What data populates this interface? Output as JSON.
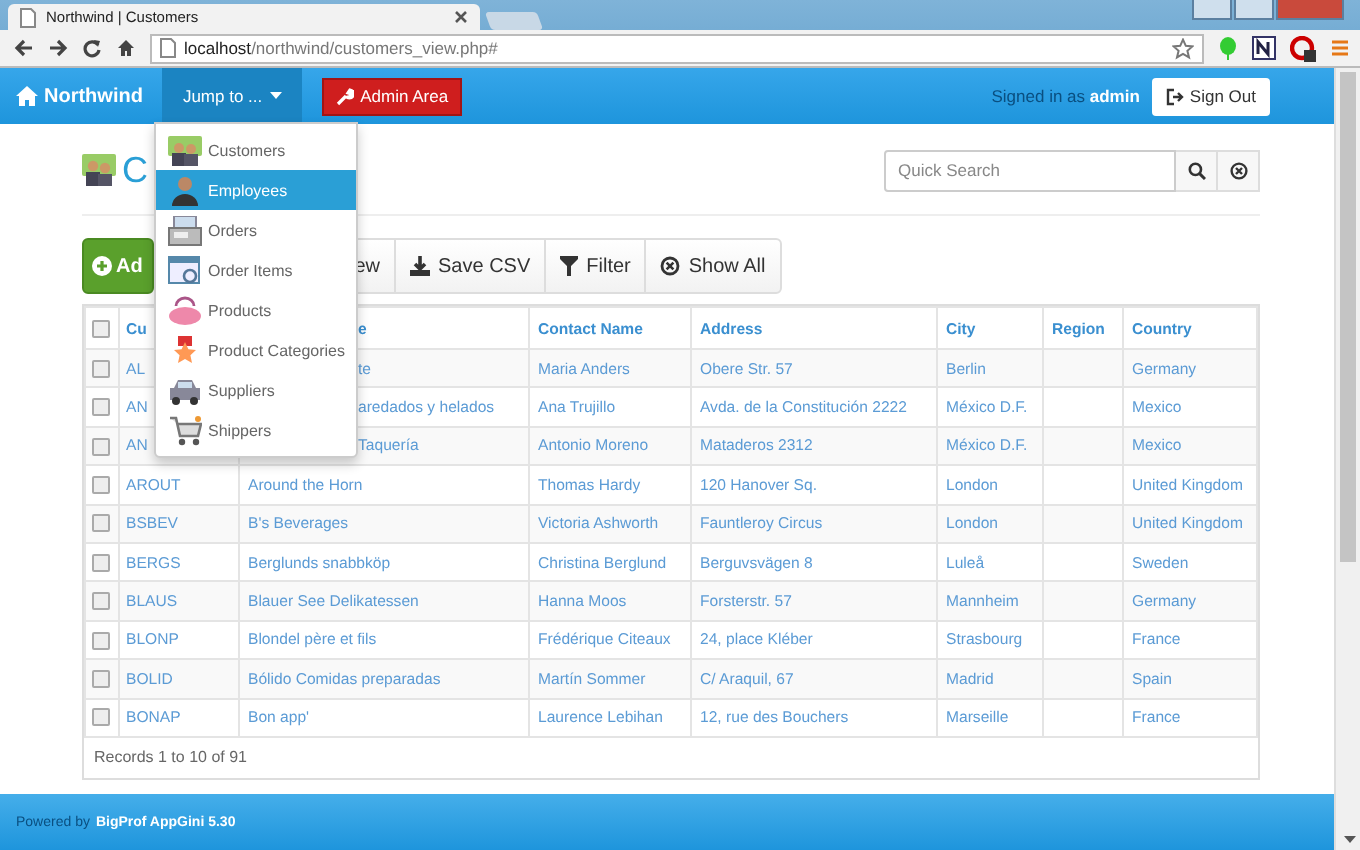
{
  "browser": {
    "tab_title": "Northwind | Customers",
    "url_host": "localhost",
    "url_path": "/northwind/customers_view.php#"
  },
  "navbar": {
    "brand": "Northwind",
    "jump_menu": "Jump to ...",
    "admin": "Admin Area",
    "signed_in_label": "Signed in as",
    "user": "admin",
    "sign_out": "Sign Out"
  },
  "jump_menu_items": [
    {
      "label": "Customers",
      "selected": false
    },
    {
      "label": "Employees",
      "selected": true
    },
    {
      "label": "Orders",
      "selected": false
    },
    {
      "label": "Order Items",
      "selected": false
    },
    {
      "label": "Products",
      "selected": false
    },
    {
      "label": "Product Categories",
      "selected": false
    },
    {
      "label": "Suppliers",
      "selected": false
    },
    {
      "label": "Shippers",
      "selected": false
    }
  ],
  "page": {
    "title": "C",
    "search_placeholder": "Quick Search"
  },
  "actions": [
    {
      "label": "Ad",
      "kind": "add"
    },
    {
      "label": "ew",
      "kind": "covered"
    },
    {
      "label": "Save CSV",
      "kind": "save"
    },
    {
      "label": "Filter",
      "kind": "filter"
    },
    {
      "label": "Show All",
      "kind": "showall"
    }
  ],
  "table": {
    "select_all_checked": false,
    "columns": [
      {
        "label": "Cu",
        "covered": false
      },
      {
        "label": "e",
        "covered": true
      },
      {
        "label": "Contact Name",
        "covered": false
      },
      {
        "label": "Address",
        "covered": false
      },
      {
        "label": "City",
        "covered": false
      },
      {
        "label": "Region",
        "covered": false
      },
      {
        "label": "Country",
        "covered": false
      }
    ],
    "rows": [
      {
        "id": "AL",
        "company": "te",
        "covered": true,
        "checked": false,
        "contact": "Maria Anders",
        "address": "Obere Str. 57",
        "city": "Berlin",
        "country": "Germany"
      },
      {
        "id": "AN",
        "company": "aredados y helados",
        "covered": true,
        "checked": false,
        "contact": "Ana Trujillo",
        "address": "Avda. de la Constitución 2222",
        "city": "México D.F.",
        "country": "Mexico"
      },
      {
        "id": "AN",
        "company": "Taquería",
        "covered": true,
        "checked": false,
        "contact": "Antonio Moreno",
        "address": "Mataderos 2312",
        "city": "México D.F.",
        "country": "Mexico"
      },
      {
        "id": "AROUT",
        "company": "Around the Horn",
        "covered": false,
        "checked": false,
        "contact": "Thomas Hardy",
        "address": "120 Hanover Sq.",
        "city": "London",
        "country": "United Kingdom"
      },
      {
        "id": "BSBEV",
        "company": "B's Beverages",
        "covered": false,
        "checked": false,
        "contact": "Victoria Ashworth",
        "address": "Fauntleroy Circus",
        "city": "London",
        "country": "United Kingdom"
      },
      {
        "id": "BERGS",
        "company": "Berglunds snabbköp",
        "covered": false,
        "checked": false,
        "contact": "Christina Berglund",
        "address": "Berguvsvägen 8",
        "city": "Luleå",
        "country": "Sweden"
      },
      {
        "id": "BLAUS",
        "company": "Blauer See Delikatessen",
        "covered": false,
        "checked": false,
        "contact": "Hanna Moos",
        "address": "Forsterstr. 57",
        "city": "Mannheim",
        "country": "Germany"
      },
      {
        "id": "BLONP",
        "company": "Blondel père et fils",
        "covered": false,
        "checked": false,
        "contact": "Frédérique Citeaux",
        "address": "24, place Kléber",
        "city": "Strasbourg",
        "country": "France"
      },
      {
        "id": "BOLID",
        "company": "Bólido Comidas preparadas",
        "covered": false,
        "checked": false,
        "contact": "Martín Sommer",
        "address": "C/ Araquil, 67",
        "city": "Madrid",
        "country": "Spain"
      },
      {
        "id": "BONAP",
        "company": "Bon app'",
        "covered": false,
        "checked": false,
        "contact": "Laurence Lebihan",
        "address": "12, rue des Bouchers",
        "city": "Marseille",
        "country": "France"
      }
    ],
    "records": "Records 1 to 10 of 91"
  },
  "footer": {
    "label": "Powered by",
    "link": "BigProf AppGini 5.30"
  }
}
